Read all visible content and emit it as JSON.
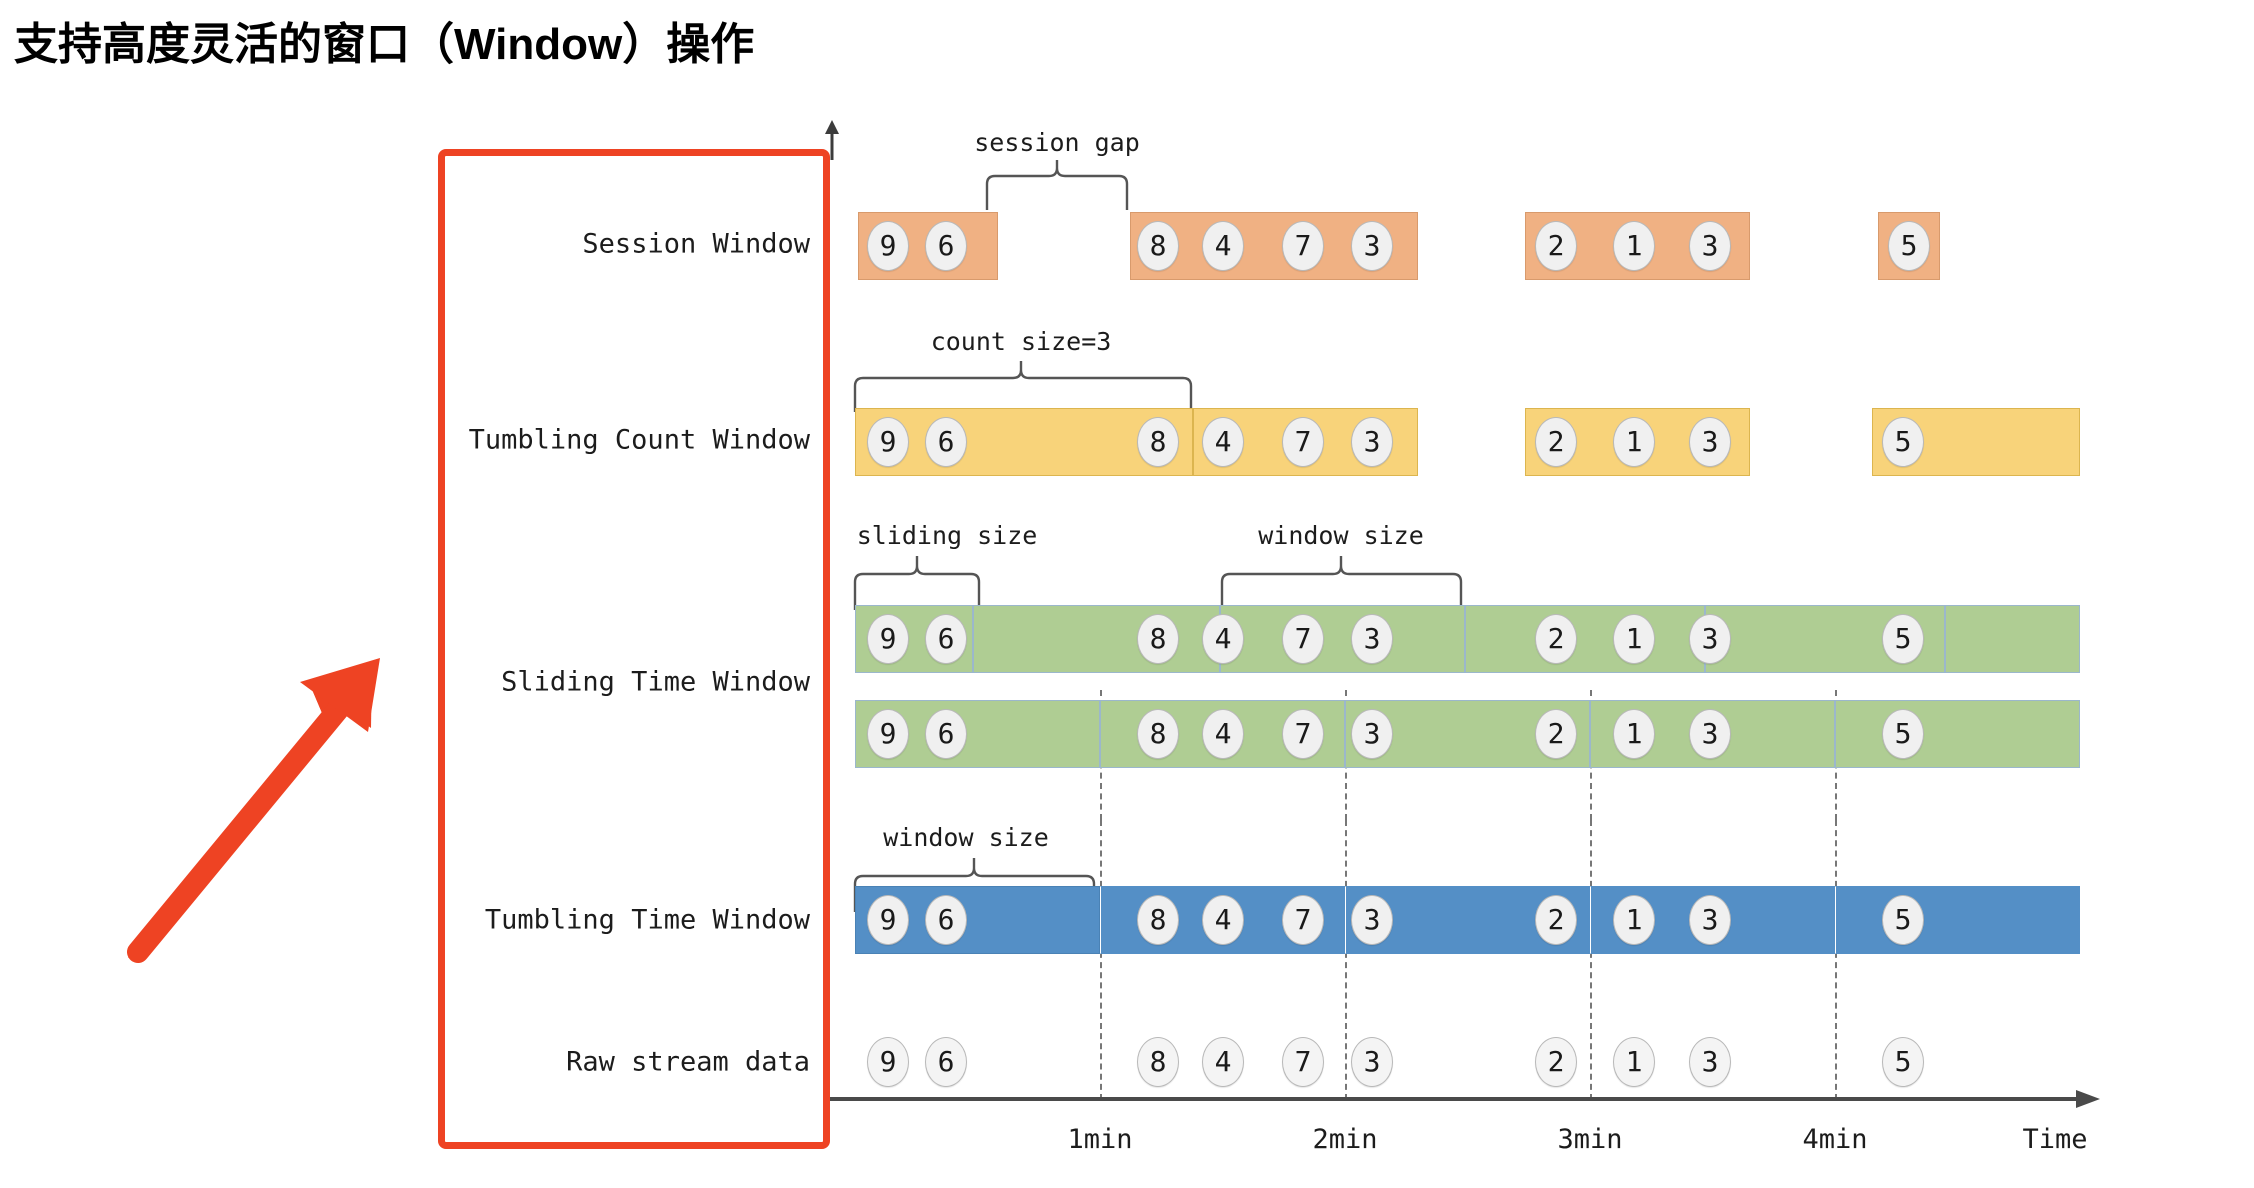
{
  "slide": {
    "title": "支持高度灵活的窗口（Window）操作"
  },
  "diagram": {
    "axis": {
      "x_axis_label": "Time",
      "tick_labels": [
        "1min",
        "2min",
        "3min",
        "4min"
      ]
    },
    "row_labels": [
      "Session Window",
      "Tumbling Count Window",
      "Sliding Time Window",
      "Tumbling Time Window",
      "Raw stream data"
    ],
    "brace_labels": {
      "session_gap": "session gap",
      "count_size": "count size=3",
      "sliding_size": "sliding size",
      "window_size_sliding": "window size",
      "window_size_tumbling": "window size"
    },
    "colors": {
      "session": "#f0b183",
      "count": "#f8d37a",
      "sliding": "#afcd93",
      "tumbling": "#548fc6",
      "annotation": "#ee4323",
      "token": "#f0f0f0"
    }
  },
  "chart_data": {
    "type": "table",
    "title": "Flink window types timeline",
    "xlabel": "Time",
    "ylabel": "",
    "x_ticks": [
      "1min",
      "2min",
      "3min",
      "4min"
    ],
    "raw_stream": [
      {
        "value": 9,
        "t": 0.08
      },
      {
        "value": 6,
        "t": 0.16
      },
      {
        "value": 8,
        "t": 1.1
      },
      {
        "value": 4,
        "t": 1.3
      },
      {
        "value": 7,
        "t": 1.62
      },
      {
        "value": 3,
        "t": 1.93
      },
      {
        "value": 2,
        "t": 2.82
      },
      {
        "value": 1,
        "t": 3.1
      },
      {
        "value": 3,
        "t": 3.33
      },
      {
        "value": 5,
        "t": 3.97
      }
    ],
    "rows": [
      {
        "name": "Session Window",
        "color": "#f0b183",
        "groups": [
          {
            "values": [
              9,
              6
            ]
          },
          {
            "values": [
              8,
              4,
              7,
              3
            ]
          },
          {
            "values": [
              2,
              1,
              3
            ]
          },
          {
            "values": [
              5
            ]
          }
        ]
      },
      {
        "name": "Tumbling Count Window",
        "color": "#f8d37a",
        "groups": [
          {
            "values": [
              9,
              6,
              8
            ]
          },
          {
            "values": [
              4,
              7,
              3
            ]
          },
          {
            "values": [
              2,
              1,
              3
            ]
          },
          {
            "values": [
              5
            ]
          }
        ]
      },
      {
        "name": "Sliding Time Window",
        "color": "#afcd93",
        "lanes": [
          {
            "groups": [
              {
                "values": [
                  9,
                  6
                ]
              },
              {
                "values": [
                  8
                ]
              },
              {
                "values": [
                  4,
                  7,
                  3
                ]
              },
              {
                "values": [
                  2,
                  1
                ]
              },
              {
                "values": [
                  3,
                  5
                ]
              },
              {
                "values": []
              }
            ]
          },
          {
            "groups": [
              {
                "values": [
                  9,
                  6
                ]
              },
              {
                "values": [
                  8,
                  4,
                  7
                ]
              },
              {
                "values": [
                  3,
                  2
                ]
              },
              {
                "values": [
                  1,
                  3
                ]
              },
              {
                "values": [
                  5
                ]
              }
            ]
          }
        ]
      },
      {
        "name": "Tumbling Time Window",
        "color": "#548fc6",
        "groups": [
          {
            "values": [
              9,
              6
            ]
          },
          {
            "values": [
              8,
              4,
              7
            ]
          },
          {
            "values": [
              3,
              2
            ]
          },
          {
            "values": [
              1,
              3
            ]
          },
          {
            "values": [
              5
            ]
          }
        ]
      }
    ],
    "annotations": [
      "session gap",
      "count size=3",
      "sliding size",
      "window size",
      "window size"
    ]
  }
}
